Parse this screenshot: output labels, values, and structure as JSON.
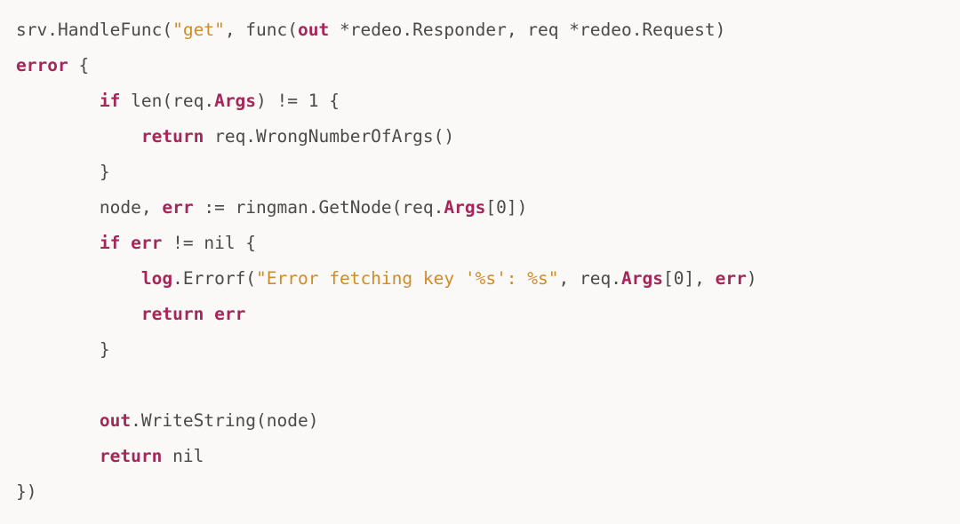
{
  "code": {
    "language": "go",
    "tokens": [
      [
        {
          "t": "id",
          "v": "srv.HandleFunc("
        },
        {
          "t": "str",
          "v": "\"get\""
        },
        {
          "t": "id",
          "v": ", func("
        },
        {
          "t": "kw",
          "v": "out"
        },
        {
          "t": "id",
          "v": " *redeo.Responder, req *redeo.Request)"
        }
      ],
      [
        {
          "t": "kw",
          "v": "error"
        },
        {
          "t": "id",
          "v": " {"
        }
      ],
      [
        {
          "t": "id",
          "v": "        "
        },
        {
          "t": "kw",
          "v": "if"
        },
        {
          "t": "id",
          "v": " len(req."
        },
        {
          "t": "kw",
          "v": "Args"
        },
        {
          "t": "id",
          "v": ") != "
        },
        {
          "t": "num",
          "v": "1"
        },
        {
          "t": "id",
          "v": " {"
        }
      ],
      [
        {
          "t": "id",
          "v": "            "
        },
        {
          "t": "kw",
          "v": "return"
        },
        {
          "t": "id",
          "v": " req.WrongNumberOfArgs()"
        }
      ],
      [
        {
          "t": "id",
          "v": "        }"
        }
      ],
      [
        {
          "t": "id",
          "v": "        node, "
        },
        {
          "t": "kw",
          "v": "err"
        },
        {
          "t": "id",
          "v": " := ringman.GetNode(req."
        },
        {
          "t": "kw",
          "v": "Args"
        },
        {
          "t": "id",
          "v": "["
        },
        {
          "t": "num",
          "v": "0"
        },
        {
          "t": "id",
          "v": "])"
        }
      ],
      [
        {
          "t": "id",
          "v": "        "
        },
        {
          "t": "kw",
          "v": "if"
        },
        {
          "t": "id",
          "v": " "
        },
        {
          "t": "kw",
          "v": "err"
        },
        {
          "t": "id",
          "v": " != nil {"
        }
      ],
      [
        {
          "t": "id",
          "v": "            "
        },
        {
          "t": "kw",
          "v": "log"
        },
        {
          "t": "id",
          "v": ".Errorf("
        },
        {
          "t": "str",
          "v": "\"Error fetching key '%s': %s\""
        },
        {
          "t": "id",
          "v": ", req."
        },
        {
          "t": "kw",
          "v": "Args"
        },
        {
          "t": "id",
          "v": "["
        },
        {
          "t": "num",
          "v": "0"
        },
        {
          "t": "id",
          "v": "], "
        },
        {
          "t": "kw",
          "v": "err"
        },
        {
          "t": "id",
          "v": ")"
        }
      ],
      [
        {
          "t": "id",
          "v": "            "
        },
        {
          "t": "kw",
          "v": "return"
        },
        {
          "t": "id",
          "v": " "
        },
        {
          "t": "kw",
          "v": "err"
        }
      ],
      [
        {
          "t": "id",
          "v": "        }"
        }
      ],
      [
        {
          "t": "id",
          "v": ""
        }
      ],
      [
        {
          "t": "id",
          "v": "        "
        },
        {
          "t": "kw",
          "v": "out"
        },
        {
          "t": "id",
          "v": ".WriteString(node)"
        }
      ],
      [
        {
          "t": "id",
          "v": "        "
        },
        {
          "t": "kw",
          "v": "return"
        },
        {
          "t": "id",
          "v": " nil"
        }
      ],
      [
        {
          "t": "id",
          "v": "})"
        }
      ]
    ]
  },
  "colors": {
    "background": "#faf9f7",
    "default_text": "#4a4a4a",
    "keyword": "#a62659",
    "string": "#d08c24"
  }
}
